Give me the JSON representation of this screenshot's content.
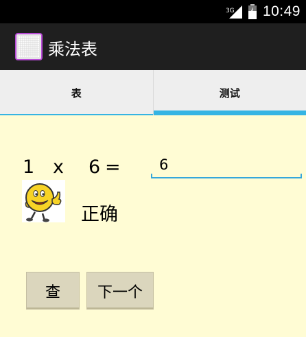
{
  "status_bar": {
    "network": "3G",
    "time": "10:49",
    "icons": [
      "signal-icon",
      "battery-icon"
    ]
  },
  "action_bar": {
    "title": "乘法表",
    "icon": "app-grid-icon"
  },
  "tabs": [
    {
      "label": "表",
      "selected": false
    },
    {
      "label": "测试",
      "selected": true
    }
  ],
  "quiz": {
    "multiplicand": "1",
    "operator": "x",
    "multiplier": "6",
    "equals": "=",
    "answer_value": "6",
    "result_text": "正确",
    "result_icon": "smiley-thumbs-up-icon"
  },
  "buttons": {
    "check_label": "查",
    "next_label": "下一个"
  },
  "colors": {
    "accent": "#35b4e3",
    "background": "#fffcd4",
    "action_bar": "#1f1f1f",
    "button": "#dbd6bd"
  }
}
